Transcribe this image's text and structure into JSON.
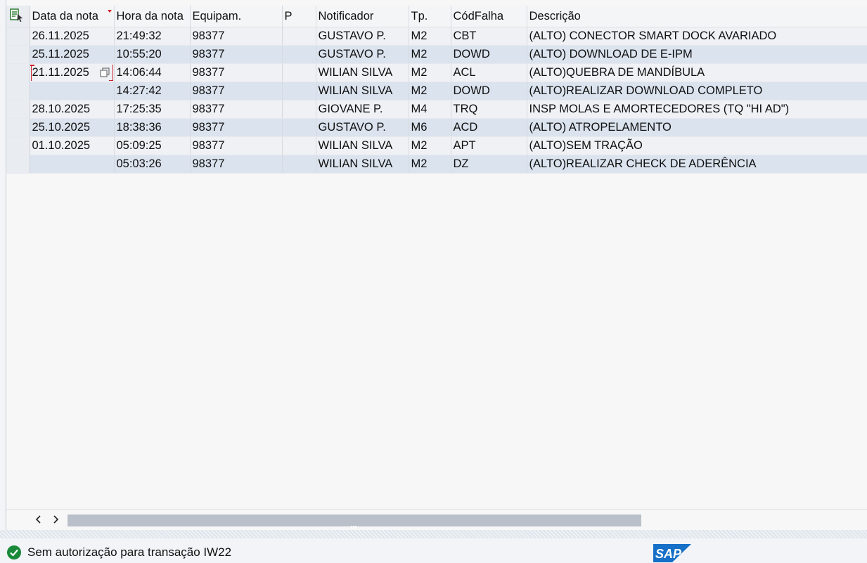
{
  "grid": {
    "columns": [
      "Data da nota",
      "Hora da nota",
      "Equipam.",
      "P",
      "Notificador",
      "Tp.",
      "CódFalha",
      "Descrição"
    ],
    "rows": [
      {
        "data": "26.11.2025",
        "hora": "21:49:32",
        "equip": "98377",
        "p": "",
        "notificador": "GUSTAVO P.",
        "tp": "M2",
        "codfalha": "CBT",
        "descricao": "(ALTO) CONECTOR SMART DOCK AVARIADO"
      },
      {
        "data": "25.11.2025",
        "hora": "10:55:20",
        "equip": "98377",
        "p": "",
        "notificador": "GUSTAVO P.",
        "tp": "M2",
        "codfalha": "DOWD",
        "descricao": "(ALTO) DOWNLOAD DE E-IPM"
      },
      {
        "data": "21.11.2025",
        "hora": "14:06:44",
        "equip": "98377",
        "p": "",
        "notificador": "WILIAN SILVA",
        "tp": "M2",
        "codfalha": "ACL",
        "descricao": "(ALTO)QUEBRA DE MANDÍBULA"
      },
      {
        "data": "",
        "hora": "14:27:42",
        "equip": "98377",
        "p": "",
        "notificador": "WILIAN SILVA",
        "tp": "M2",
        "codfalha": "DOWD",
        "descricao": "(ALTO)REALIZAR DOWNLOAD COMPLETO"
      },
      {
        "data": "28.10.2025",
        "hora": "17:25:35",
        "equip": "98377",
        "p": "",
        "notificador": "GIOVANE P.",
        "tp": "M4",
        "codfalha": "TRQ",
        "descricao": "INSP MOLAS E AMORTECEDORES (TQ \"HI AD\")"
      },
      {
        "data": "25.10.2025",
        "hora": "18:38:36",
        "equip": "98377",
        "p": "",
        "notificador": "GUSTAVO P.",
        "tp": "M6",
        "codfalha": "ACD",
        "descricao": "(ALTO) ATROPELAMENTO"
      },
      {
        "data": "01.10.2025",
        "hora": "05:09:25",
        "equip": "98377",
        "p": "",
        "notificador": "WILIAN SILVA",
        "tp": "M2",
        "codfalha": "APT",
        "descricao": "(ALTO)SEM TRAÇÃO"
      },
      {
        "data": "",
        "hora": "05:03:26",
        "equip": "98377",
        "p": "",
        "notificador": "WILIAN SILVA",
        "tp": "M2",
        "codfalha": "DZ",
        "descricao": "(ALTO)REALIZAR CHECK DE ADERÊNCIA"
      }
    ]
  },
  "status": {
    "message": "Sem autorização para transação IW22",
    "icon": "success-check-icon",
    "color": "#1a8a3a"
  },
  "brand": {
    "logo_text": "SAP",
    "color": "#1670c7"
  },
  "colors": {
    "row_odd": "#eff1f4",
    "row_even": "#dbe3ee",
    "focus": "#d0202a",
    "sort_marker": "#d0202a"
  }
}
